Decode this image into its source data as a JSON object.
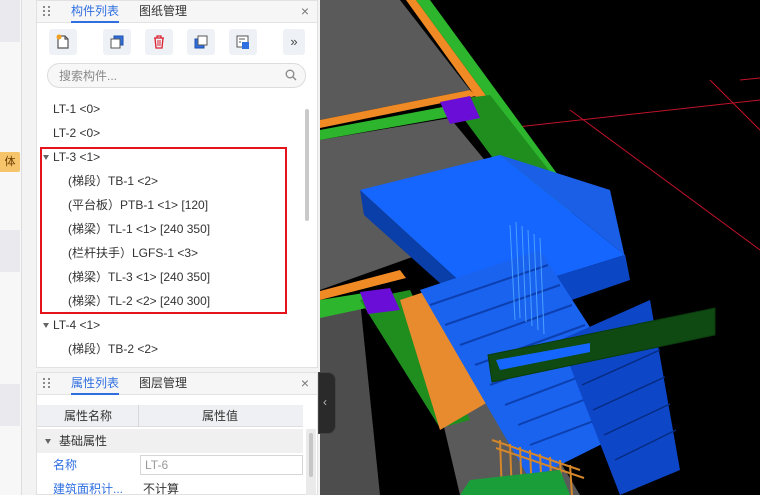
{
  "top_panel": {
    "tabs": [
      {
        "label": "构件列表",
        "active": true
      },
      {
        "label": "图纸管理",
        "active": false
      }
    ],
    "close_glyph": "×",
    "toolbar": {
      "buttons": [
        "new-component-icon",
        "copy-icon",
        "delete-icon",
        "duplicate-icon",
        "layer-copy-icon"
      ],
      "more_glyph": "»"
    },
    "search": {
      "placeholder": "搜索构件..."
    },
    "tree": [
      {
        "label": "LT-1 <0>",
        "level": 0,
        "expanded": false
      },
      {
        "label": "LT-2 <0>",
        "level": 0,
        "expanded": false
      },
      {
        "label": "LT-3 <1>",
        "level": 0,
        "expanded": true
      },
      {
        "label": "(梯段）TB-1 <2>",
        "level": 1
      },
      {
        "label": "(平台板）PTB-1 <1> [120]",
        "level": 1
      },
      {
        "label": "(梯梁）TL-1 <1> [240 350]",
        "level": 1
      },
      {
        "label": "(栏杆扶手）LGFS-1 <3>",
        "level": 1
      },
      {
        "label": "(梯梁）TL-3 <1> [240 350]",
        "level": 1
      },
      {
        "label": "(梯梁）TL-2 <2> [240 300]",
        "level": 1
      },
      {
        "label": "LT-4 <1>",
        "level": 0,
        "expanded": true
      },
      {
        "label": "(梯段）TB-2 <2>",
        "level": 1
      }
    ]
  },
  "bottom_panel": {
    "tabs": [
      {
        "label": "属性列表",
        "active": true
      },
      {
        "label": "图层管理",
        "active": false
      }
    ],
    "close_glyph": "×",
    "columns": {
      "name": "属性名称",
      "value": "属性值"
    },
    "section": "基础属性",
    "rows": [
      {
        "name": "名称",
        "value": "LT-6"
      },
      {
        "name": "建筑面积计...",
        "value": "不计算"
      }
    ]
  },
  "left_strip": {
    "tag_text": "体验"
  },
  "viewport": {
    "collapse_glyph": "‹"
  },
  "colors": {
    "accent": "#2f6fe0",
    "highlight": "#e5141c",
    "stair_blue": "#1565ff",
    "slab_grey": "#5a5a5a",
    "beam_green": "#2db52d",
    "beam_orange": "#f08a24",
    "column_purple": "#6a0dd6"
  }
}
